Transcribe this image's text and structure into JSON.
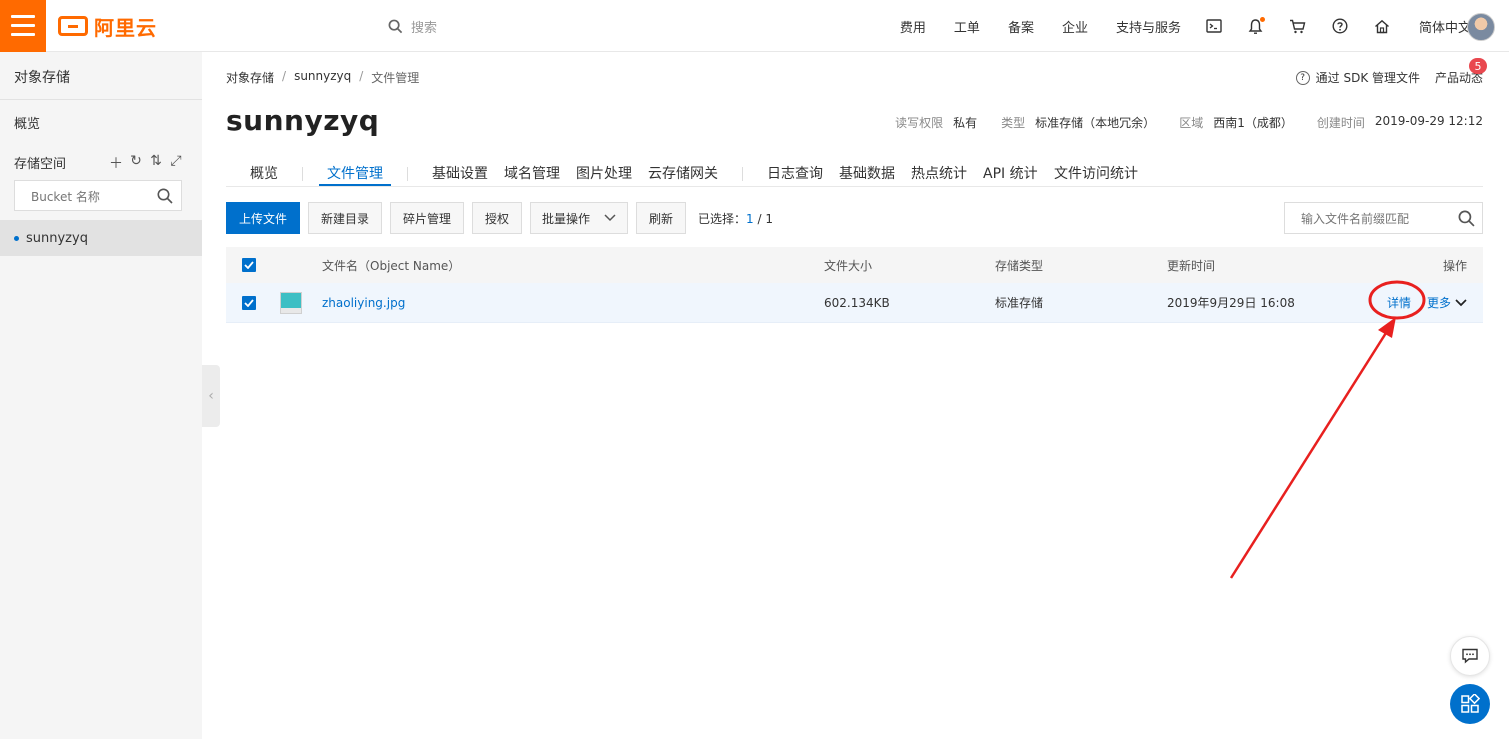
{
  "header": {
    "logo_text": "阿里云",
    "search_placeholder": "搜索",
    "nav": [
      "费用",
      "工单",
      "备案",
      "企业",
      "支持与服务"
    ],
    "language": "简体中文",
    "icons": [
      "terminal-icon",
      "bell-icon",
      "cart-icon",
      "help-icon",
      "home-icon"
    ]
  },
  "sidebar": {
    "title": "对象存储",
    "overview": "概览",
    "storage_label": "存储空间",
    "tool_icons": [
      "add-icon",
      "refresh-icon",
      "sort-icon",
      "expand-icon"
    ],
    "bucket_placeholder": "Bucket 名称",
    "buckets": [
      "sunnyzyq"
    ]
  },
  "breadcrumb": [
    "对象存储",
    "sunnyzyq",
    "文件管理"
  ],
  "top_right": {
    "sdk_link": "通过 SDK 管理文件",
    "news": "产品动态",
    "badge": "5"
  },
  "bucket": {
    "name": "sunnyzyq",
    "meta": [
      {
        "label": "读写权限",
        "value": "私有"
      },
      {
        "label": "类型",
        "value": "标准存储（本地冗余）"
      },
      {
        "label": "区域",
        "value": "西南1（成都）"
      },
      {
        "label": "创建时间",
        "value": "2019-09-29 12:12"
      }
    ]
  },
  "tabs": [
    "概览",
    "文件管理",
    "基础设置",
    "域名管理",
    "图片处理",
    "云存储网关",
    "日志查询",
    "基础数据",
    "热点统计",
    "API 统计",
    "文件访问统计"
  ],
  "active_tab": "文件管理",
  "toolbar": {
    "upload": "上传文件",
    "new_dir": "新建目录",
    "fragments": "碎片管理",
    "auth": "授权",
    "batch": "批量操作",
    "refresh": "刷新",
    "selected_label": "已选择：",
    "selected_count": "1",
    "selected_sep": " / ",
    "selected_total": "1",
    "file_search_placeholder": "输入文件名前缀匹配"
  },
  "table": {
    "headers": {
      "name": "文件名（Object Name）",
      "size": "文件大小",
      "storage": "存储类型",
      "updated": "更新时间",
      "ops": "操作"
    },
    "rows": [
      {
        "name": "zhaoliying.jpg",
        "size": "602.134KB",
        "storage": "标准存储",
        "updated": "2019年9月29日 16:08",
        "detail": "详情",
        "more": "更多"
      }
    ]
  },
  "colors": {
    "brand": "#ff6a00",
    "primary": "#0070cc",
    "annotation": "#e8201f",
    "badge": "#e9484f"
  }
}
